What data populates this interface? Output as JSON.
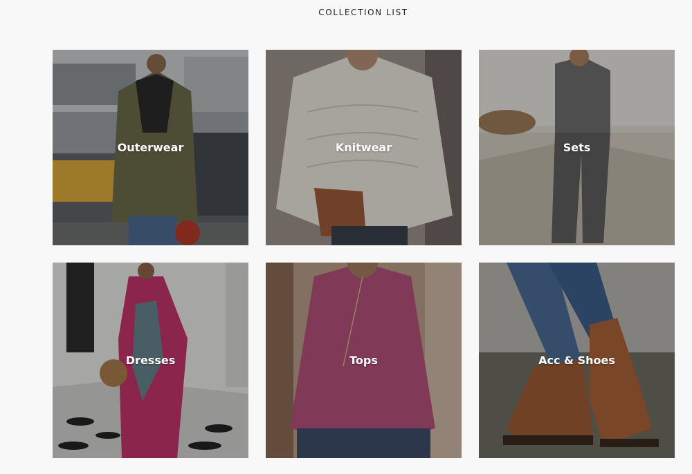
{
  "header": {
    "title": "COLLECTION LIST"
  },
  "collections": [
    {
      "label": "Outerwear",
      "icon": "outerwear-image"
    },
    {
      "label": "Knitwear",
      "icon": "knitwear-image"
    },
    {
      "label": "Sets",
      "icon": "sets-image"
    },
    {
      "label": "Dresses",
      "icon": "dresses-image"
    },
    {
      "label": "Tops",
      "icon": "tops-image"
    },
    {
      "label": "Acc & Shoes",
      "icon": "acc-shoes-image"
    }
  ],
  "colors": {
    "background": "#f8f8f8",
    "label": "#ffffff",
    "title": "#222222"
  }
}
